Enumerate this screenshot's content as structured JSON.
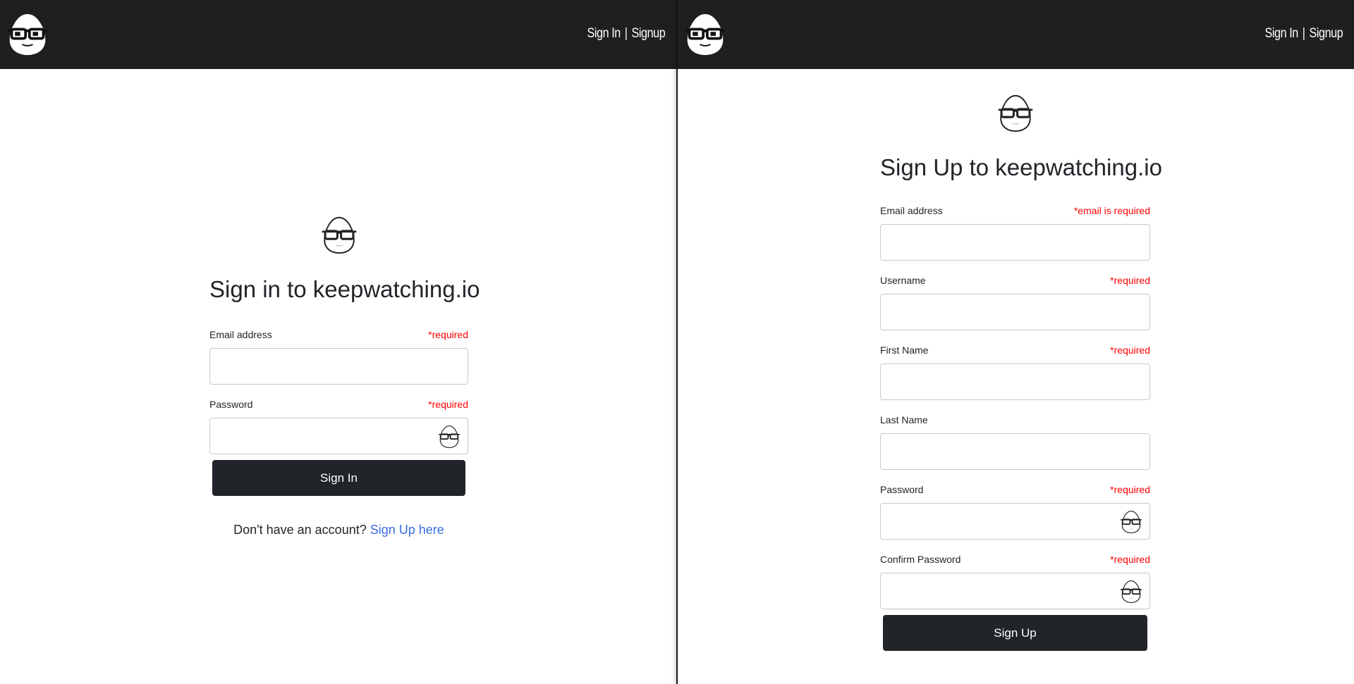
{
  "navbar": {
    "sign_in_link": "Sign In",
    "separator": "|",
    "signup_link": "Signup",
    "logo_icon": "egg-glasses-logo"
  },
  "signin": {
    "title": "Sign in to keepwatching.io",
    "email": {
      "label": "Email address",
      "required": "*required",
      "value": ""
    },
    "password": {
      "label": "Password",
      "required": "*required",
      "value": "",
      "toggle_icon": "egg-glasses-eye-icon"
    },
    "submit_label": "Sign In",
    "helper_text": "Don't have an account?",
    "helper_link": "Sign Up here"
  },
  "signup": {
    "title": "Sign Up to keepwatching.io",
    "email": {
      "label": "Email address",
      "required": "*email is required",
      "value": ""
    },
    "username": {
      "label": "Username",
      "required": "*required",
      "value": ""
    },
    "first_name": {
      "label": "First Name",
      "required": "*required",
      "value": ""
    },
    "last_name": {
      "label": "Last Name",
      "value": ""
    },
    "password": {
      "label": "Password",
      "required": "*required",
      "value": "",
      "toggle_icon": "egg-glasses-eye-icon"
    },
    "confirm_password": {
      "label": "Confirm Password",
      "required": "*required",
      "value": "",
      "toggle_icon": "egg-glasses-eye-icon"
    },
    "submit_label": "Sign Up"
  },
  "colors": {
    "navbar_bg": "#1f1f1f",
    "button_bg": "#212529",
    "required": "#ff0000",
    "link": "#3b6ddf"
  }
}
